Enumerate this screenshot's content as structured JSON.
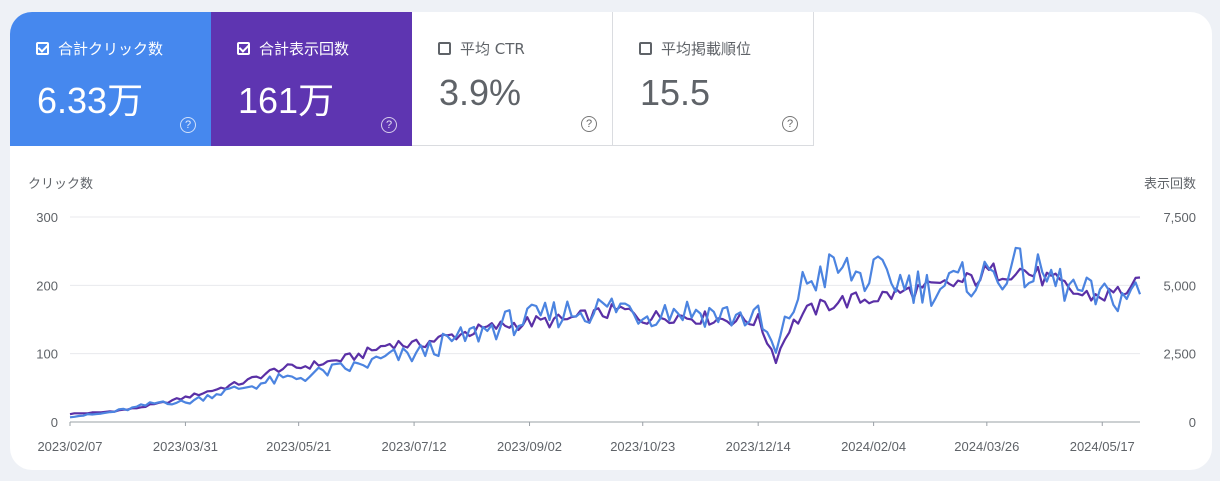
{
  "metrics": [
    {
      "label": "合計クリック数",
      "value": "6.33万",
      "checked": true,
      "color": "#4688ee"
    },
    {
      "label": "合計表示回数",
      "value": "161万",
      "checked": true,
      "color": "#5e35b1"
    },
    {
      "label": "平均 CTR",
      "value": "3.9%",
      "checked": false
    },
    {
      "label": "平均掲載順位",
      "value": "15.5",
      "checked": false
    }
  ],
  "chart_data": {
    "type": "line",
    "left_axis_label": "クリック数",
    "right_axis_label": "表示回数",
    "left_ticks": [
      "300",
      "200",
      "100",
      "0"
    ],
    "right_ticks": [
      "7,500",
      "5,000",
      "2,500",
      "0"
    ],
    "ylim_left": [
      0,
      300
    ],
    "ylim_right": [
      0,
      7500
    ],
    "grid": true,
    "x_tick_labels": [
      "2023/02/07",
      "2023/03/31",
      "2023/05/21",
      "2023/07/12",
      "2023/09/02",
      "2023/10/23",
      "2023/12/14",
      "2024/02/04",
      "2024/03/26",
      "2024/05/17"
    ],
    "x_ticks_dates": [
      "2023-02-07",
      "2023-03-31",
      "2023-05-21",
      "2023-07-12",
      "2023-09-02",
      "2023-10-23",
      "2023-12-14",
      "2024-02-04",
      "2024-03-26",
      "2024-05-17"
    ],
    "x_range": [
      "2023-02-07",
      "2024-06-03"
    ],
    "series": [
      {
        "name": "クリック数",
        "axis": "left",
        "color": "#4c84e0",
        "points": [
          [
            "2023-02-07",
            8
          ],
          [
            "2023-02-21",
            12
          ],
          [
            "2023-03-07",
            20
          ],
          [
            "2023-03-21",
            30
          ],
          [
            "2023-03-31",
            28
          ],
          [
            "2023-04-14",
            42
          ],
          [
            "2023-04-28",
            52
          ],
          [
            "2023-05-12",
            62
          ],
          [
            "2023-05-21",
            65
          ],
          [
            "2023-06-04",
            75
          ],
          [
            "2023-06-18",
            82
          ],
          [
            "2023-07-02",
            95
          ],
          [
            "2023-07-12",
            98
          ],
          [
            "2023-07-26",
            115
          ],
          [
            "2023-08-09",
            130
          ],
          [
            "2023-08-23",
            145
          ],
          [
            "2023-09-02",
            150
          ],
          [
            "2023-09-16",
            160
          ],
          [
            "2023-09-30",
            165
          ],
          [
            "2023-10-14",
            170
          ],
          [
            "2023-10-23",
            158
          ],
          [
            "2023-11-06",
            165
          ],
          [
            "2023-11-20",
            160
          ],
          [
            "2023-12-04",
            155
          ],
          [
            "2023-12-14",
            152
          ],
          [
            "2023-12-22",
            100
          ],
          [
            "2023-12-28",
            158
          ],
          [
            "2024-01-04",
            205
          ],
          [
            "2024-01-18",
            225
          ],
          [
            "2024-02-01",
            210
          ],
          [
            "2024-02-04",
            215
          ],
          [
            "2024-02-18",
            205
          ],
          [
            "2024-03-03",
            195
          ],
          [
            "2024-03-17",
            208
          ],
          [
            "2024-03-26",
            215
          ],
          [
            "2024-04-09",
            225
          ],
          [
            "2024-04-23",
            210
          ],
          [
            "2024-05-07",
            190
          ],
          [
            "2024-05-17",
            180
          ],
          [
            "2024-06-03",
            190
          ]
        ]
      },
      {
        "name": "表示回数",
        "axis": "right",
        "color": "#5a30a6",
        "points": [
          [
            "2023-02-07",
            300
          ],
          [
            "2023-02-21",
            350
          ],
          [
            "2023-03-07",
            480
          ],
          [
            "2023-03-21",
            700
          ],
          [
            "2023-03-31",
            900
          ],
          [
            "2023-04-14",
            1200
          ],
          [
            "2023-04-28",
            1500
          ],
          [
            "2023-05-12",
            1950
          ],
          [
            "2023-05-21",
            2000
          ],
          [
            "2023-06-04",
            2200
          ],
          [
            "2023-06-18",
            2450
          ],
          [
            "2023-07-02",
            2900
          ],
          [
            "2023-07-12",
            2800
          ],
          [
            "2023-07-26",
            3100
          ],
          [
            "2023-08-09",
            3350
          ],
          [
            "2023-08-23",
            3550
          ],
          [
            "2023-09-02",
            3650
          ],
          [
            "2023-09-16",
            3700
          ],
          [
            "2023-09-30",
            3900
          ],
          [
            "2023-10-14",
            4100
          ],
          [
            "2023-10-23",
            3800
          ],
          [
            "2023-11-06",
            3900
          ],
          [
            "2023-11-20",
            3800
          ],
          [
            "2023-12-04",
            3750
          ],
          [
            "2023-12-14",
            3700
          ],
          [
            "2023-12-22",
            2300
          ],
          [
            "2023-12-28",
            3450
          ],
          [
            "2024-01-04",
            4000
          ],
          [
            "2024-01-18",
            4400
          ],
          [
            "2024-02-01",
            4500
          ],
          [
            "2024-02-04",
            4550
          ],
          [
            "2024-02-18",
            4750
          ],
          [
            "2024-03-03",
            4900
          ],
          [
            "2024-03-17",
            5150
          ],
          [
            "2024-03-26",
            5450
          ],
          [
            "2024-04-09",
            5600
          ],
          [
            "2024-04-23",
            5200
          ],
          [
            "2024-05-07",
            4650
          ],
          [
            "2024-05-17",
            4600
          ],
          [
            "2024-06-03",
            5000
          ]
        ]
      }
    ]
  }
}
